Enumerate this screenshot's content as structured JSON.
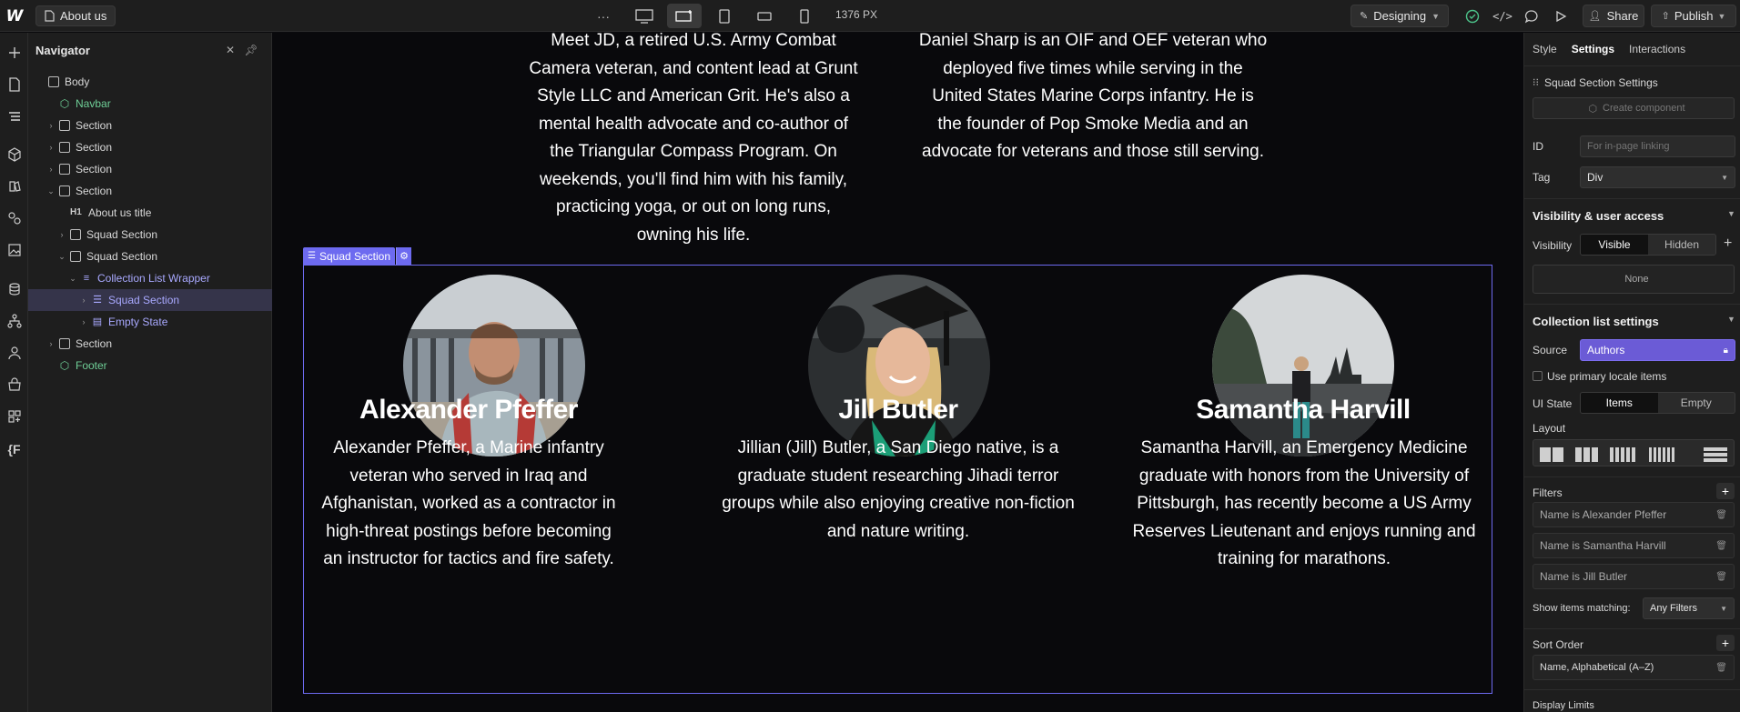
{
  "topbar": {
    "page_name": "About us",
    "width_readout": "1376 PX",
    "mode": "Designing",
    "share": "Share",
    "publish": "Publish"
  },
  "navigator": {
    "title": "Navigator",
    "tree": [
      {
        "label": "Body",
        "type": "body",
        "indent": 0,
        "chevron": false,
        "color": "default"
      },
      {
        "label": "Navbar",
        "type": "component",
        "indent": 1,
        "chevron": false,
        "color": "green"
      },
      {
        "label": "Section",
        "type": "section",
        "indent": 1,
        "chevron": "right",
        "color": "default"
      },
      {
        "label": "Section",
        "type": "section",
        "indent": 1,
        "chevron": "right",
        "color": "default"
      },
      {
        "label": "Section",
        "type": "section",
        "indent": 1,
        "chevron": "right",
        "color": "default"
      },
      {
        "label": "Section",
        "type": "section",
        "indent": 1,
        "chevron": "down",
        "color": "default"
      },
      {
        "label": "About us title",
        "type": "h1",
        "indent": 2,
        "chevron": false,
        "color": "default"
      },
      {
        "label": "Squad Section",
        "type": "div",
        "indent": 2,
        "chevron": "right",
        "color": "default"
      },
      {
        "label": "Squad Section",
        "type": "div",
        "indent": 2,
        "chevron": "down",
        "color": "default"
      },
      {
        "label": "Collection List Wrapper",
        "type": "collection",
        "indent": 3,
        "chevron": "down",
        "color": "purple"
      },
      {
        "label": "Squad Section",
        "type": "collection-list",
        "indent": 4,
        "chevron": "right",
        "color": "purple",
        "selected": true
      },
      {
        "label": "Empty State",
        "type": "collection-empty",
        "indent": 4,
        "chevron": "right",
        "color": "purple"
      },
      {
        "label": "Section",
        "type": "section",
        "indent": 1,
        "chevron": "right",
        "color": "default"
      },
      {
        "label": "Footer",
        "type": "component",
        "indent": 1,
        "chevron": false,
        "color": "green"
      }
    ]
  },
  "canvas": {
    "top_bios": [
      "Meet JD, a retired U.S. Army Combat Camera veteran, and content lead at Grunt Style LLC and American Grit. He's also a mental health advocate and co-author of the Triangular Compass Program. On weekends, you'll find him with his family, practicing yoga, or out on long runs, owning his life.",
      "Daniel Sharp is an OIF and OEF veteran who deployed five times while serving in the United States Marine Corps infantry. He is the founder of Pop Smoke Media and an advocate for veterans and those still serving."
    ],
    "selection_label": "Squad Section",
    "cards": [
      {
        "name": "Alexander Pfeffer",
        "bio": "Alexander Pfeffer, a Marine infantry veteran who served in Iraq and Afghanistan, worked as a contractor in high-threat postings before becoming an instructor for tactics and fire safety."
      },
      {
        "name": "Jill Butler",
        "bio": "Jillian (Jill) Butler, a San Diego native, is a graduate student researching Jihadi terror groups while also enjoying creative non-fiction and nature writing."
      },
      {
        "name": "Samantha Harvill",
        "bio": "Samantha Harvill, an Emergency Medicine graduate with honors from the University of Pittsburgh, has recently become a US Army Reserves Lieutenant and enjoys running and training for marathons."
      }
    ]
  },
  "right_panel": {
    "tabs": [
      "Style",
      "Settings",
      "Interactions"
    ],
    "active_tab": "Settings",
    "element_settings": "Squad Section Settings",
    "create_component": "Create component",
    "id_label": "ID",
    "id_placeholder": "For in-page linking",
    "tag_label": "Tag",
    "tag_value": "Div",
    "visibility_heading": "Visibility & user access",
    "visibility_label": "Visibility",
    "visibility_options": [
      "Visible",
      "Hidden"
    ],
    "visibility_none": "None",
    "collection_heading": "Collection list settings",
    "source_label": "Source",
    "source_value": "Authors",
    "primary_locale": "Use primary locale items",
    "ui_state_label": "UI State",
    "ui_state_options": [
      "Items",
      "Empty"
    ],
    "layout_label": "Layout",
    "filters_label": "Filters",
    "filters": [
      "Name is Alexander Pfeffer",
      "Name is Samantha Harvill",
      "Name is Jill Butler"
    ],
    "show_matching_label": "Show items matching:",
    "show_matching_value": "Any Filters",
    "sort_label": "Sort Order",
    "sort_value": "Name, Alphabetical (A–Z)",
    "display_limits": "Display Limits"
  },
  "colors": {
    "accent": "#6d6af0",
    "component_green": "#6fcf97",
    "source_purple": "#6b5bd6"
  }
}
